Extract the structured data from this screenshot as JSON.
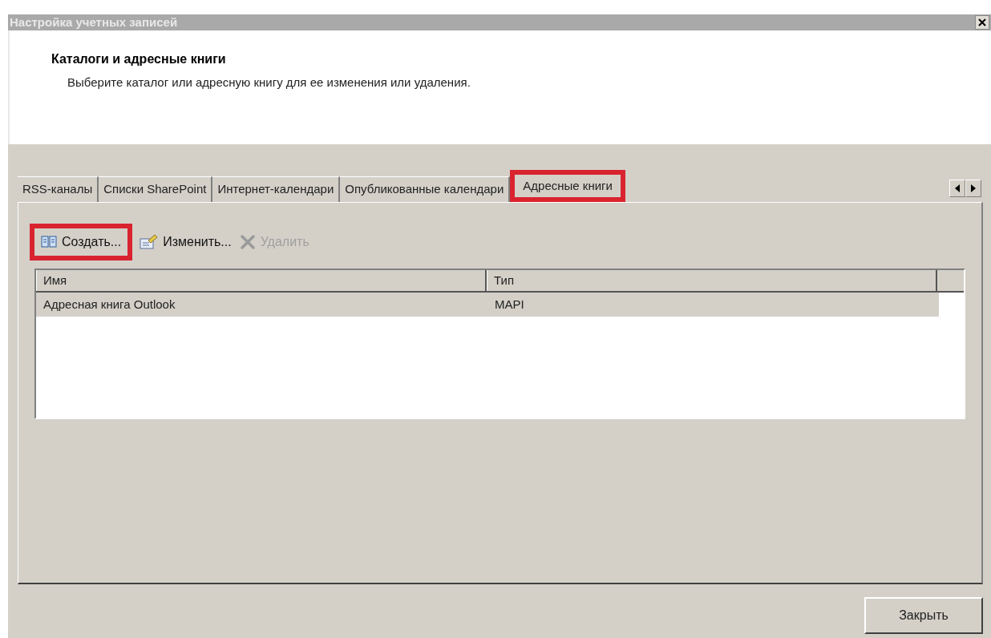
{
  "window": {
    "title": "Настройка учетных записей"
  },
  "header": {
    "heading": "Каталоги и адресные книги",
    "description": "Выберите каталог или адресную книгу для ее изменения или удаления."
  },
  "tabs": [
    {
      "label": "RSS-каналы",
      "selected": false,
      "highlighted": false
    },
    {
      "label": "Списки SharePoint",
      "selected": false,
      "highlighted": false
    },
    {
      "label": "Интернет-календари",
      "selected": false,
      "highlighted": false
    },
    {
      "label": "Опубликованные календари",
      "selected": false,
      "highlighted": false
    },
    {
      "label": "Адресные книги",
      "selected": true,
      "highlighted": true
    }
  ],
  "toolbar": [
    {
      "kind": "create",
      "label": "Создать...",
      "disabled": false,
      "highlighted": true
    },
    {
      "kind": "edit",
      "label": "Изменить...",
      "disabled": false,
      "highlighted": false
    },
    {
      "kind": "delete",
      "label": "Удалить",
      "disabled": true,
      "highlighted": false
    }
  ],
  "table": {
    "columns": [
      "Имя",
      "Тип"
    ],
    "rows": [
      {
        "cells": [
          "Адресная книга Outlook",
          "MAPI"
        ],
        "selected": true
      }
    ]
  },
  "buttons": [
    "Закрыть"
  ]
}
